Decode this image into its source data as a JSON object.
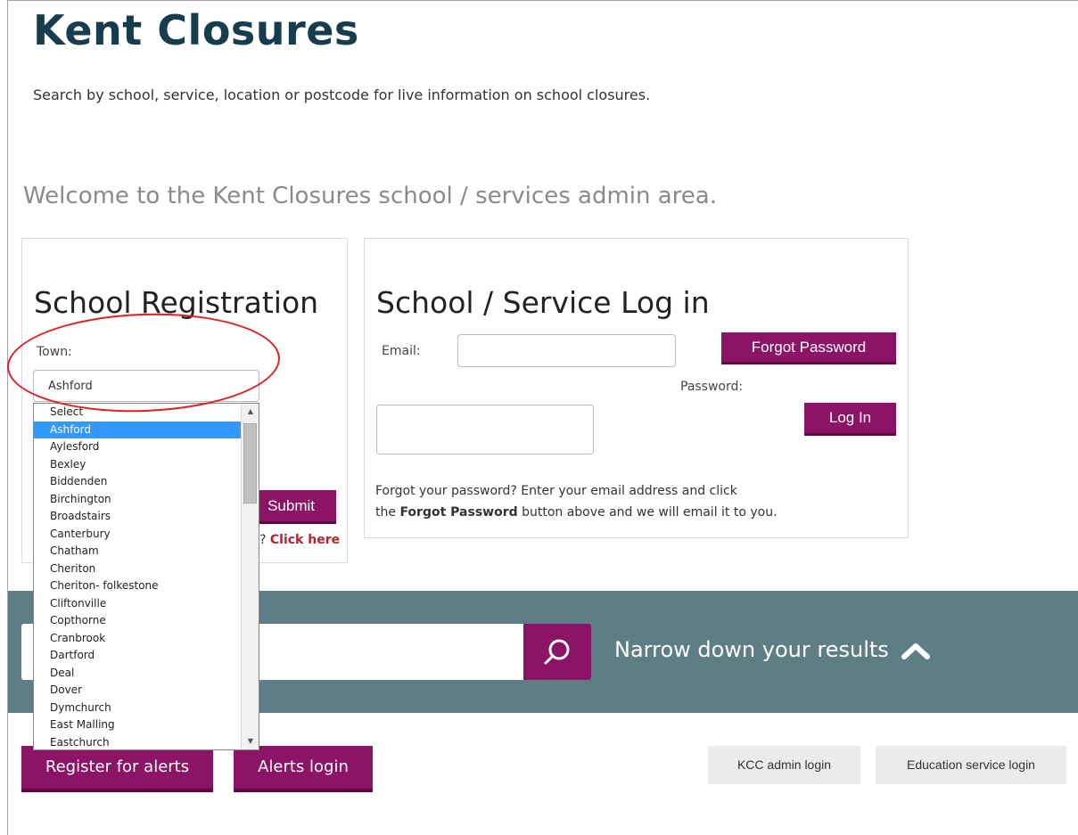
{
  "header": {
    "title": "Kent Closures",
    "intro": "Search by school, service, location or postcode for live information on school closures."
  },
  "welcome": "Welcome to the Kent Closures school / services admin area.",
  "registration": {
    "heading": "School Registration",
    "town_label": "Town:",
    "town_selected": "Ashford",
    "town_options": [
      "Select",
      "Ashford",
      "Aylesford",
      "Bexley",
      "Biddenden",
      "Birchington",
      "Broadstairs",
      "Canterbury",
      "Chatham",
      "Cheriton",
      "Cheriton- folkestone",
      "Cliftonville",
      "Copthorne",
      "Cranbrook",
      "Dartford",
      "Deal",
      "Dover",
      "Dymchurch",
      "East Malling",
      "Eastchurch"
    ],
    "highlighted_option_index": 1,
    "submit_label": "Submit",
    "click_prefix": "?",
    "click_link": "Click here"
  },
  "login": {
    "heading": "School / Service Log in",
    "email_label": "Email:",
    "password_label": "Password:",
    "forgot_button": "Forgot Password",
    "login_button": "Log In",
    "help_line1": "Forgot your password? Enter your email address and click",
    "help_line2_prefix": "the",
    "help_line2_bold": "Forgot Password",
    "help_line2_suffix": "button above and we will email it to you."
  },
  "search": {
    "narrow_label": "Narrow down your results"
  },
  "footer": {
    "register_alerts": "Register for alerts",
    "alerts_login": "Alerts login",
    "kcc_admin_login": "KCC admin login",
    "education_service_login": "Education service login"
  },
  "colors": {
    "brand_purple": "#8b1466",
    "title_navy": "#163d4e",
    "search_band": "#5e7e86",
    "annotation_red": "#e02020",
    "selection_blue": "#3399ff"
  },
  "icons": [
    "search-icon",
    "chevron-up-icon",
    "scroll-up-icon",
    "scroll-down-icon"
  ]
}
